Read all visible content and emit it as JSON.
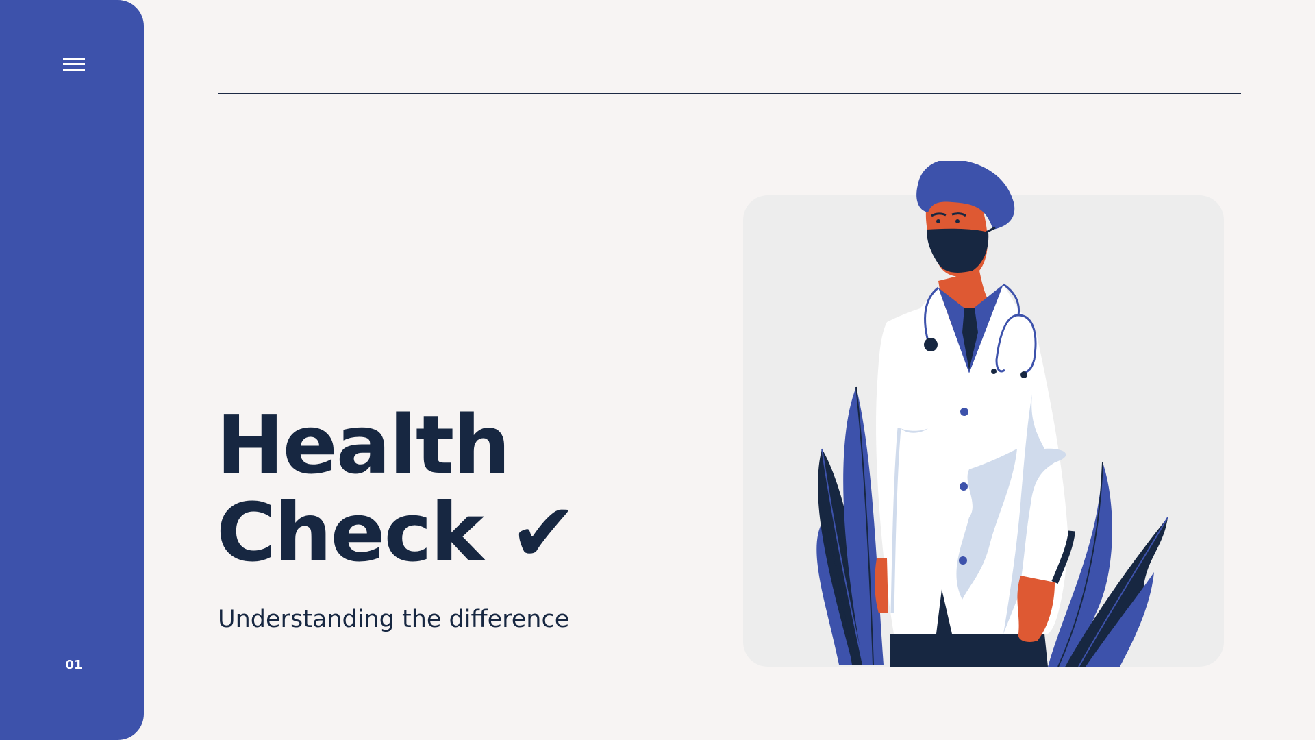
{
  "sidebar": {
    "menu_icon": "hamburger-menu-icon",
    "slide_number": "01"
  },
  "slide": {
    "title_line1": "Health",
    "title_line2": "Check ✔",
    "subtitle": "Understanding the difference"
  },
  "illustration": {
    "subject": "doctor-illustration"
  },
  "colors": {
    "sidebar": "#3d52ab",
    "background": "#f7f4f3",
    "text": "#172741",
    "card": "#ededed",
    "accent_orange": "#de5933"
  }
}
